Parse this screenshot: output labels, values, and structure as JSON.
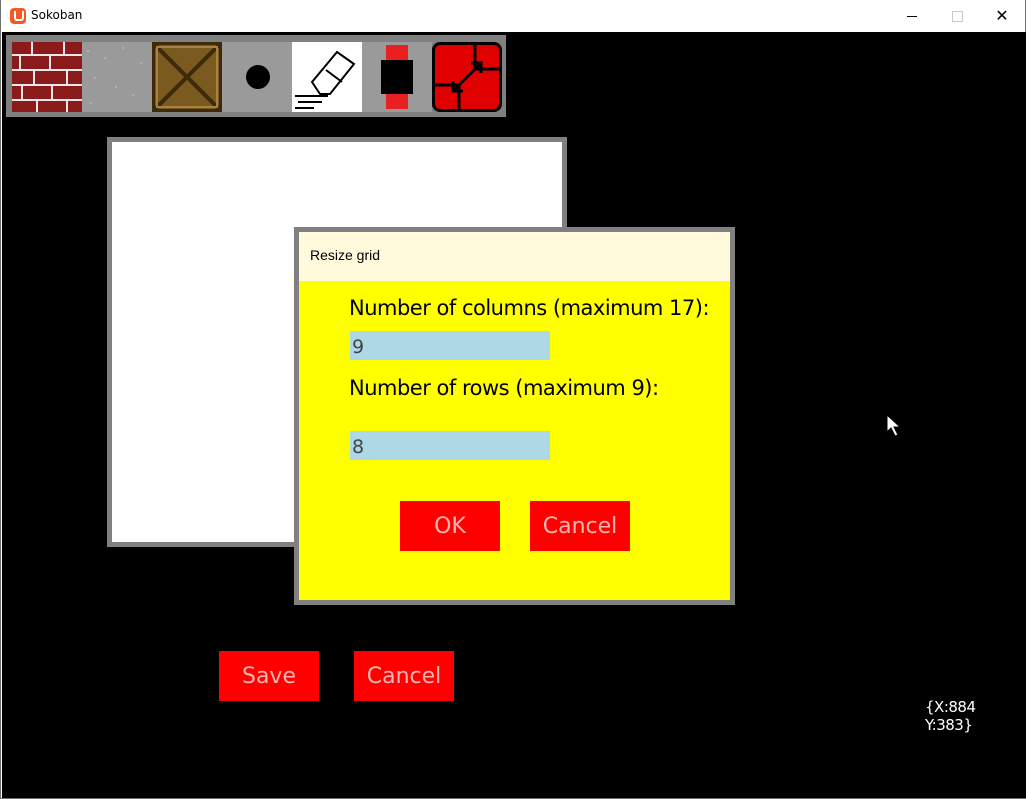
{
  "window": {
    "title": "Sokoban",
    "close_glyph": "✕"
  },
  "toolbar": {
    "tools": [
      {
        "name": "wall",
        "icon": "wall-brick-icon"
      },
      {
        "name": "floor",
        "icon": "floor-tile-icon"
      },
      {
        "name": "crate",
        "icon": "crate-icon"
      },
      {
        "name": "target",
        "icon": "target-dot-icon"
      },
      {
        "name": "eraser",
        "icon": "eraser-icon"
      },
      {
        "name": "player",
        "icon": "player-icon"
      },
      {
        "name": "resize",
        "icon": "resize-arrows-icon"
      }
    ]
  },
  "dialog": {
    "title": "Resize grid",
    "columns_label": "Number of columns (maximum 17):",
    "columns_value": "9",
    "rows_label": "Number of rows (maximum 9):",
    "rows_value": "8",
    "ok_label": "OK",
    "cancel_label": "Cancel"
  },
  "editor": {
    "save_label": "Save",
    "cancel_label": "Cancel"
  },
  "mouse_coords": "{X:884 Y:383}",
  "colors": {
    "background": "#000000",
    "dialog_bg": "#ffff00",
    "dialog_header_bg": "#fffadc",
    "button_bg": "#ff0000",
    "button_text": "#ffb4b4",
    "input_bg": "#add8e6",
    "frame_gray": "#808080"
  }
}
